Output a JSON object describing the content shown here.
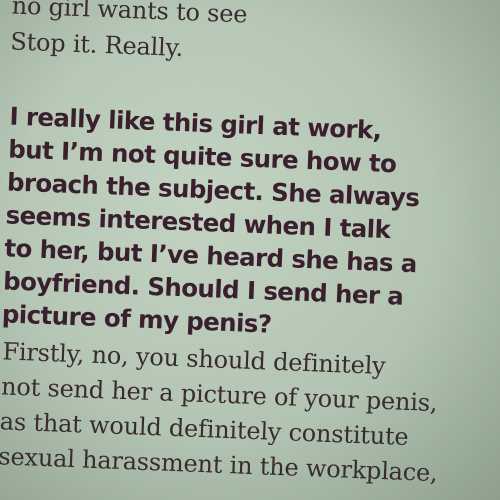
{
  "top_lines": [
    "no girl wants to see",
    "Stop it. Really."
  ],
  "question_lines": [
    "I really like this girl at work,",
    "but I’m not quite sure how to",
    "broach the subject. She always",
    "seems interested when I talk",
    "to her, but I’ve heard she has a",
    "boyfriend. Should I send her a",
    "picture of my penis?"
  ],
  "answer_lines": [
    "Firstly, no, you should definitely",
    "not send her a picture of your penis,",
    "as that would definitely constitute",
    "sexual harassment in the workplace,"
  ]
}
